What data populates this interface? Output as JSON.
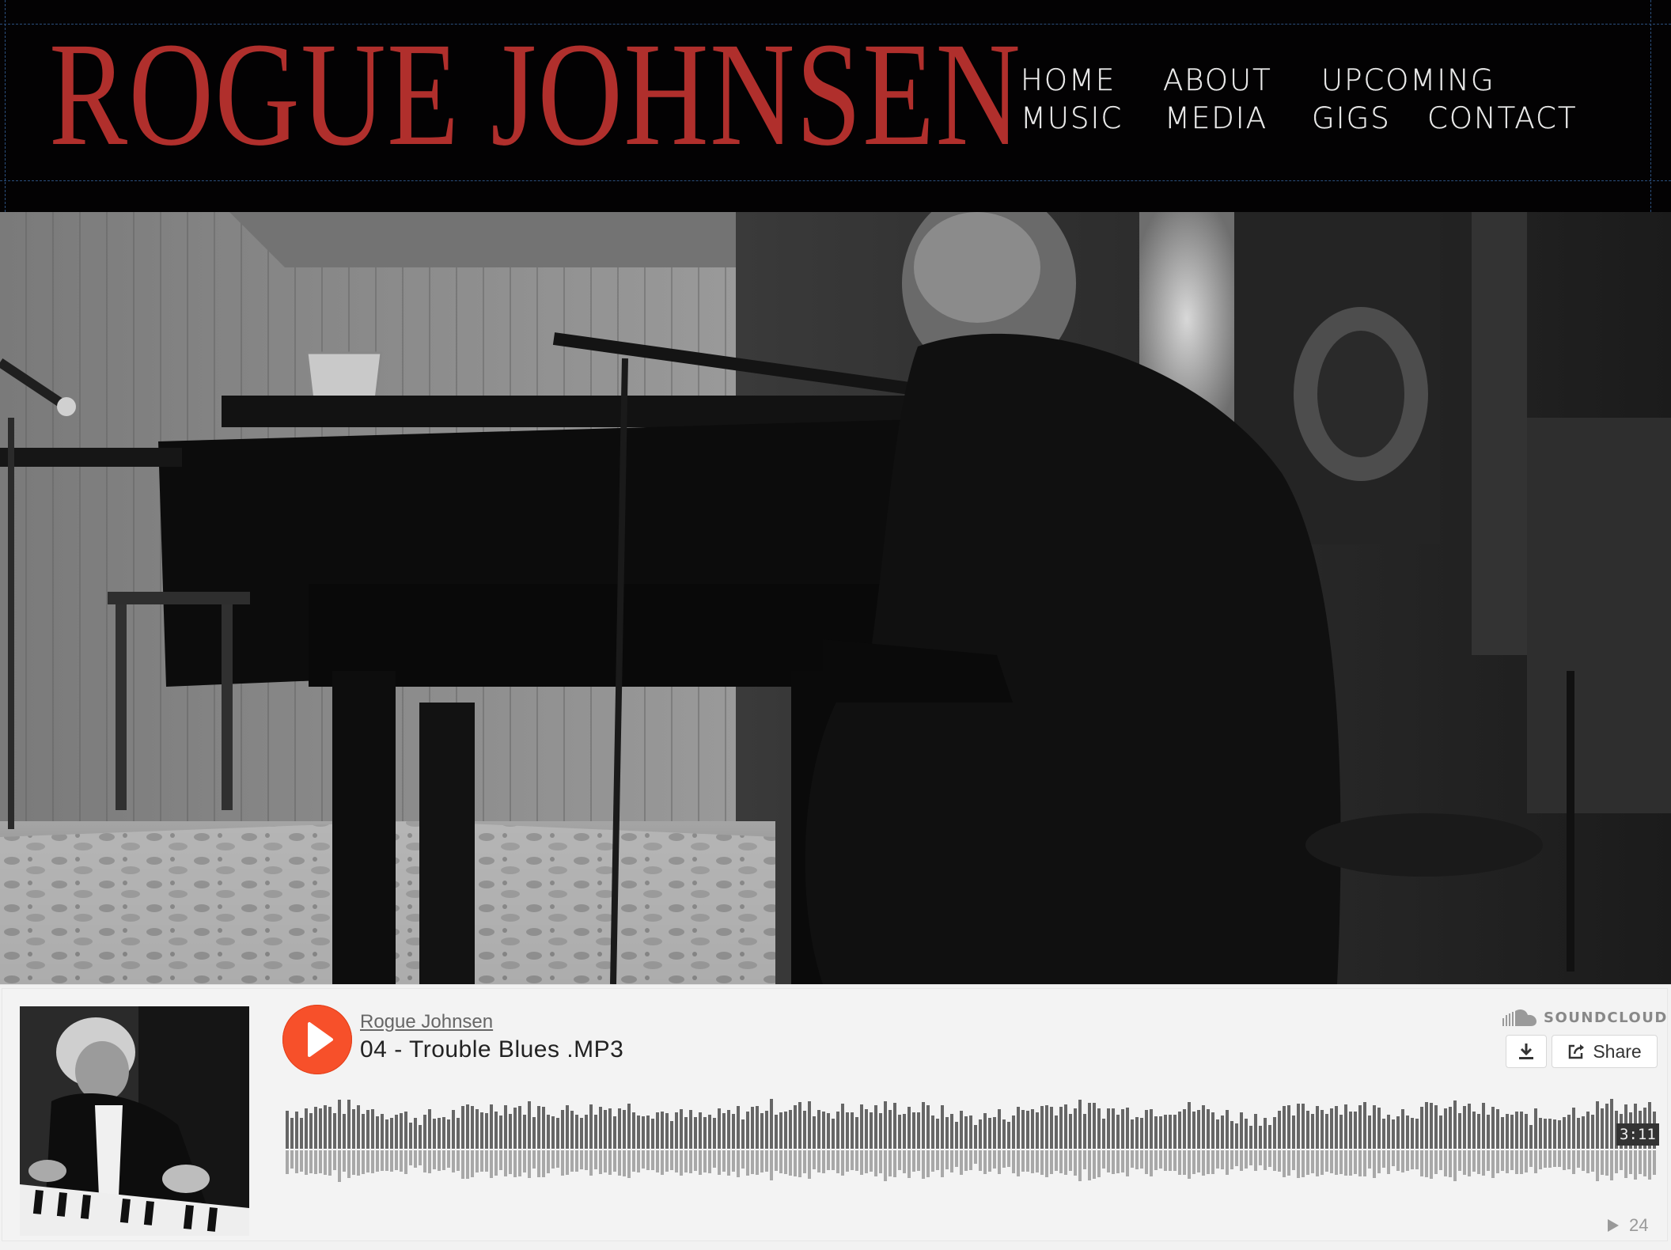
{
  "header": {
    "site_title": "ROGUE JOHNSEN",
    "nav": {
      "home": "HOME",
      "about": "ABOUT",
      "upcoming": "UPCOMING",
      "music": "MUSIC",
      "media": "MEDIA",
      "gigs": "GIGS",
      "contact": "CONTACT"
    }
  },
  "player": {
    "user": "Rogue Johnsen",
    "track_title": "04 - Trouble Blues .MP3",
    "brand": "SOUNDCLOUD",
    "share_label": "Share",
    "duration": "3:11",
    "play_count": "24"
  },
  "icons": {
    "play": "play-icon",
    "download": "download-icon",
    "share": "share-icon",
    "soundcloud_logo": "soundcloud-cloud-icon",
    "plays": "play-count-icon"
  },
  "colors": {
    "title_red": "#b02f2c",
    "nav_text": "#e9e9e9",
    "header_bg": "#030203",
    "play_orange": "#f7502a"
  }
}
